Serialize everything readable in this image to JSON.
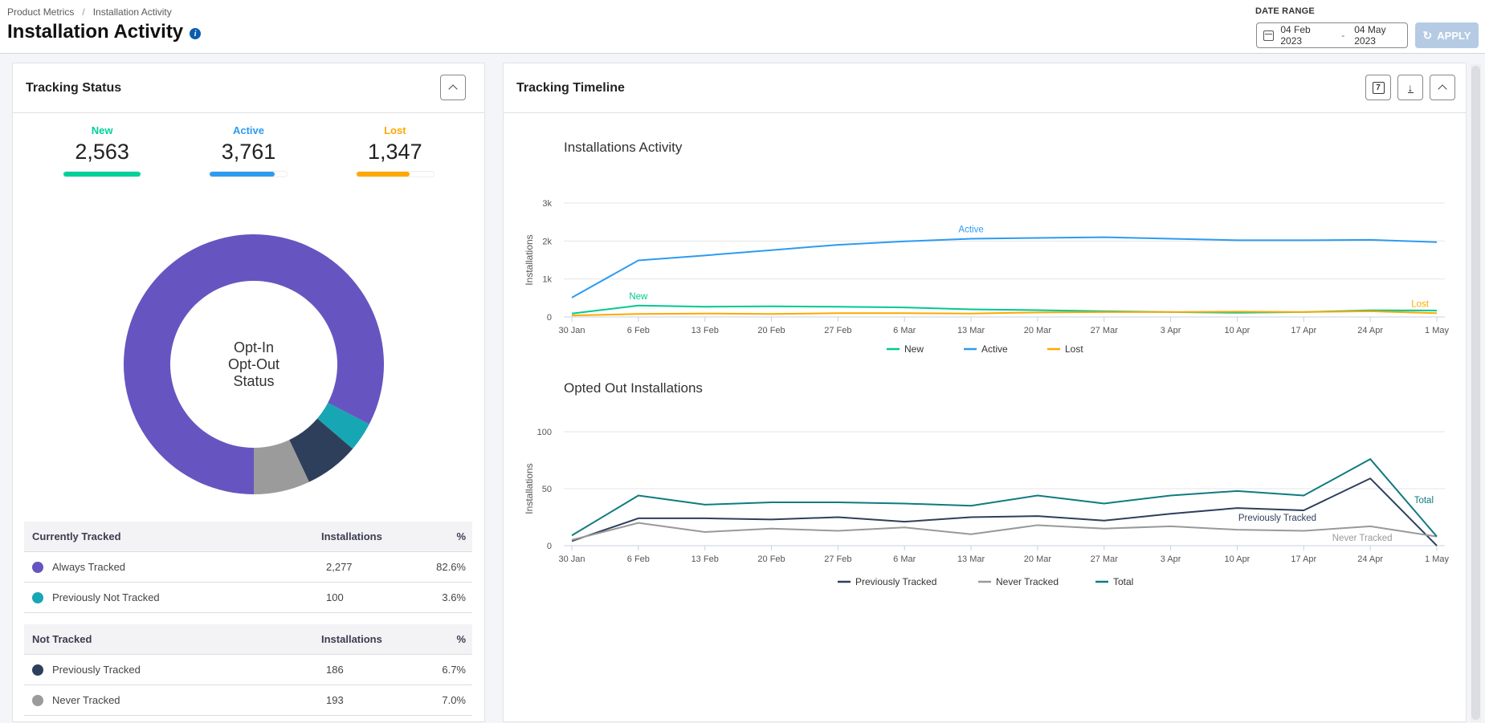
{
  "header": {
    "breadcrumb": [
      "Product Metrics",
      "Installation Activity"
    ],
    "title": "Installation Activity",
    "info_icon": "info-icon",
    "date_range_label": "DATE RANGE",
    "date_start": "04 Feb 2023",
    "date_sep": "-",
    "date_end": "04 May 2023",
    "apply_label": "APPLY"
  },
  "tracking_status": {
    "title": "Tracking Status",
    "stats": [
      {
        "label": "New",
        "value": "2,563",
        "color": "#00d19a",
        "fill": 1.0
      },
      {
        "label": "Active",
        "value": "3,761",
        "color": "#2d9bf0",
        "fill": 0.84
      },
      {
        "label": "Lost",
        "value": "1,347",
        "color": "#ffa800",
        "fill": 0.69
      }
    ],
    "donut_center": [
      "Opt-In",
      "Opt-Out",
      "Status"
    ],
    "currently_tracked": {
      "header": [
        "Currently Tracked",
        "Installations",
        "%"
      ],
      "rows": [
        {
          "label": "Always Tracked",
          "installations": "2,277",
          "percent": "82.6%",
          "color": "#6655c0"
        },
        {
          "label": "Previously Not Tracked",
          "installations": "100",
          "percent": "3.6%",
          "color": "#17a6b4"
        }
      ]
    },
    "not_tracked": {
      "header": [
        "Not Tracked",
        "Installations",
        "%"
      ],
      "rows": [
        {
          "label": "Previously Tracked",
          "installations": "186",
          "percent": "6.7%",
          "color": "#2e3f5c"
        },
        {
          "label": "Never Tracked",
          "installations": "193",
          "percent": "7.0%",
          "color": "#9b9b9b"
        }
      ]
    }
  },
  "tracking_timeline": {
    "title": "Tracking Timeline",
    "buttons": [
      "calendar-7-icon",
      "download-icon",
      "chevron-up-icon"
    ],
    "calendar_day": "7"
  },
  "chart_data": [
    {
      "type": "pie",
      "title": "Opt-In Opt-Out Status",
      "categories": [
        "Always Tracked",
        "Previously Not Tracked",
        "Previously Tracked",
        "Never Tracked"
      ],
      "values": [
        2277,
        100,
        186,
        193
      ],
      "colors": [
        "#6655c0",
        "#17a6b4",
        "#2e3f5c",
        "#9b9b9b"
      ]
    },
    {
      "type": "line",
      "title": "Installations Activity",
      "xlabel": "",
      "ylabel": "Installations",
      "ylim": [
        0,
        3000
      ],
      "yticks": [
        0,
        1000,
        2000,
        3000
      ],
      "ytick_labels": [
        "0",
        "1k",
        "2k",
        "3k"
      ],
      "x": [
        "30 Jan",
        "6 Feb",
        "13 Feb",
        "20 Feb",
        "27 Feb",
        "6 Mar",
        "13 Mar",
        "20 Mar",
        "27 Mar",
        "3 Apr",
        "10 Apr",
        "17 Apr",
        "24 Apr",
        "1 May"
      ],
      "grid": true,
      "legend": "bottom",
      "series": [
        {
          "name": "New",
          "color": "#00c98f",
          "values": [
            90,
            300,
            270,
            280,
            270,
            250,
            200,
            180,
            150,
            130,
            110,
            130,
            175,
            170
          ],
          "annotation": {
            "text": "New",
            "index": 1
          }
        },
        {
          "name": "Active",
          "color": "#2d9bf0",
          "values": [
            510,
            1490,
            1620,
            1760,
            1900,
            1990,
            2060,
            2080,
            2100,
            2060,
            2020,
            2020,
            2030,
            1970
          ],
          "annotation": {
            "text": "Active",
            "index": 6
          }
        },
        {
          "name": "Lost",
          "color": "#ffa800",
          "values": [
            40,
            80,
            90,
            80,
            100,
            100,
            90,
            120,
            130,
            130,
            140,
            130,
            150,
            100
          ],
          "annotation": {
            "text": "Lost",
            "index": 13
          }
        }
      ]
    },
    {
      "type": "line",
      "title": "Opted Out Installations",
      "xlabel": "",
      "ylabel": "Installations",
      "ylim": [
        0,
        100
      ],
      "yticks": [
        0,
        50,
        100
      ],
      "ytick_labels": [
        "0",
        "50",
        "100"
      ],
      "x": [
        "30 Jan",
        "6 Feb",
        "13 Feb",
        "20 Feb",
        "27 Feb",
        "6 Mar",
        "13 Mar",
        "20 Mar",
        "27 Mar",
        "3 Apr",
        "10 Apr",
        "17 Apr",
        "24 Apr",
        "1 May"
      ],
      "grid": true,
      "legend": "bottom",
      "series": [
        {
          "name": "Previously Tracked",
          "color": "#2e3f5c",
          "values": [
            4,
            24,
            24,
            23,
            25,
            21,
            25,
            26,
            22,
            28,
            33,
            31,
            59,
            0
          ],
          "annotation": {
            "text": "Previously Tracked",
            "index": 10
          }
        },
        {
          "name": "Never Tracked",
          "color": "#999999",
          "values": [
            5,
            20,
            12,
            15,
            13,
            16,
            10,
            18,
            15,
            17,
            14,
            13,
            17,
            8
          ],
          "annotation": {
            "text": "Never Tracked",
            "index": 12
          }
        },
        {
          "name": "Total",
          "color": "#0f7b80",
          "values": [
            9,
            44,
            36,
            38,
            38,
            37,
            35,
            44,
            37,
            44,
            48,
            44,
            76,
            8
          ],
          "annotation": {
            "text": "Total",
            "index": 13
          }
        }
      ]
    }
  ]
}
